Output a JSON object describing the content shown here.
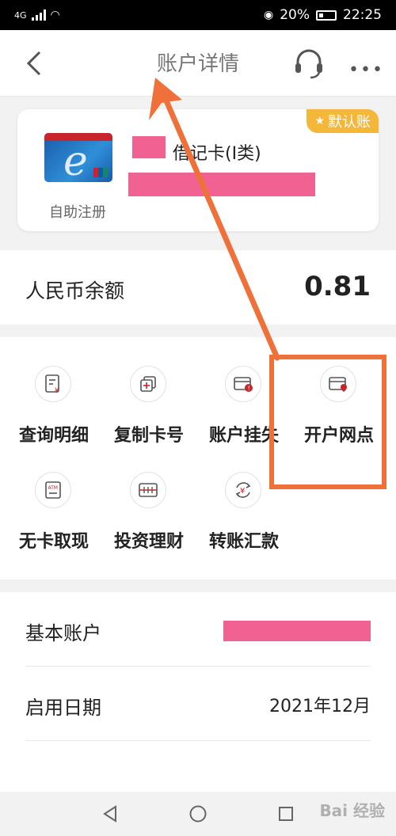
{
  "status_bar": {
    "network": "4G",
    "battery": "20%",
    "time": "22:25"
  },
  "nav": {
    "title": "账户详情"
  },
  "card": {
    "name": "借记卡(I类)",
    "registration": "自助注册",
    "default_badge": "默认账"
  },
  "balance": {
    "label": "人民币余额",
    "value": "0.81"
  },
  "functions": [
    {
      "label": "查询明细",
      "icon": "detail-icon"
    },
    {
      "label": "复制卡号",
      "icon": "copy-icon"
    },
    {
      "label": "账户挂失",
      "icon": "report-loss-icon"
    },
    {
      "label": "开户网点",
      "icon": "branch-location-icon"
    },
    {
      "label": "无卡取现",
      "icon": "atm-icon"
    },
    {
      "label": "投资理财",
      "icon": "invest-icon"
    },
    {
      "label": "转账汇款",
      "icon": "transfer-icon"
    }
  ],
  "info": {
    "basic_account_label": "基本账户",
    "open_date_label": "启用日期",
    "open_date_value": "2021年12月"
  },
  "watermark": "Bai 经验",
  "colors": {
    "accent": "#f0703a",
    "badge": "#f5b73a",
    "redact": "#f06292"
  }
}
